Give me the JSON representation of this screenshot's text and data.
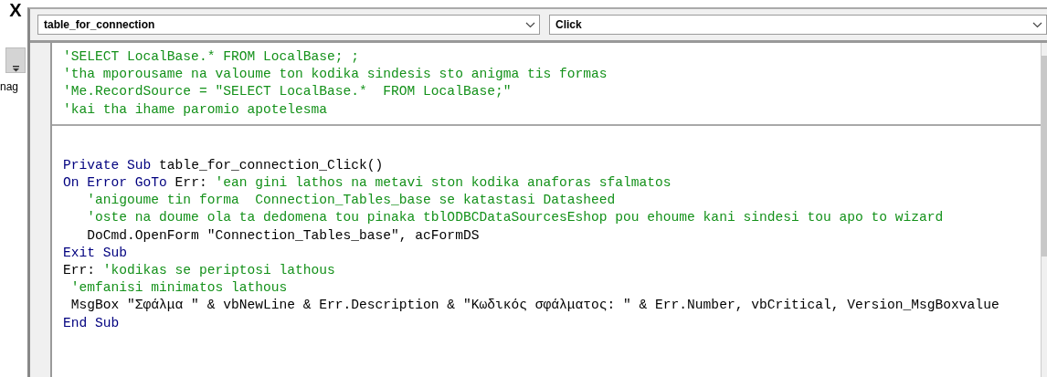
{
  "left_panel": {
    "close_glyph": "X",
    "label": "nag"
  },
  "object_dropdown": {
    "value": "table_for_connection"
  },
  "procedure_dropdown": {
    "value": "Click"
  },
  "declarations": [
    {
      "segments": [
        {
          "kind": "comment",
          "text": "'SELECT LocalBase.* FROM LocalBase; ;"
        }
      ]
    },
    {
      "segments": [
        {
          "kind": "comment",
          "text": "'tha mporousame na valoume ton kodika sindesis sto anigma tis formas"
        }
      ]
    },
    {
      "segments": [
        {
          "kind": "comment",
          "text": "'Me.RecordSource = \"SELECT LocalBase.*  FROM LocalBase;\""
        }
      ]
    },
    {
      "segments": [
        {
          "kind": "comment",
          "text": "'kai tha ihame paromio apotelesma"
        }
      ]
    }
  ],
  "procedures": [
    {
      "segments": [
        {
          "kind": "keyword",
          "text": "Private Sub"
        },
        {
          "kind": "plain",
          "text": " table_for_connection_Click()"
        }
      ]
    },
    {
      "segments": [
        {
          "kind": "keyword",
          "text": "On Error GoTo"
        },
        {
          "kind": "plain",
          "text": " Err: "
        },
        {
          "kind": "comment",
          "text": "'ean gini lathos na metavi ston kodika anaforas sfalmatos"
        }
      ]
    },
    {
      "segments": [
        {
          "kind": "comment",
          "text": "   'anigoume tin forma  Connection_Tables_base se katastasi Datasheed"
        }
      ]
    },
    {
      "segments": [
        {
          "kind": "comment",
          "text": "   'oste na doume ola ta dedomena tou pinaka tblODBCDataSourcesEshop pou ehoume kani sindesi tou apo to wizard"
        }
      ]
    },
    {
      "segments": [
        {
          "kind": "plain",
          "text": "   DoCmd.OpenForm \"Connection_Tables_base\", acFormDS"
        }
      ]
    },
    {
      "segments": [
        {
          "kind": "keyword",
          "text": "Exit Sub"
        }
      ]
    },
    {
      "segments": [
        {
          "kind": "plain",
          "text": "Err: "
        },
        {
          "kind": "comment",
          "text": "'kodikas se periptosi lathous"
        }
      ]
    },
    {
      "segments": [
        {
          "kind": "comment",
          "text": " 'emfanisi minimatos lathous"
        }
      ]
    },
    {
      "segments": [
        {
          "kind": "plain",
          "text": " MsgBox \"Σφάλμα \" & vbNewLine & Err.Description & \"Κωδικός σφάλματος: \" & Err.Number, vbCritical, Version_MsgBoxvalue"
        }
      ]
    },
    {
      "segments": [
        {
          "kind": "keyword",
          "text": "End Sub"
        }
      ]
    }
  ]
}
